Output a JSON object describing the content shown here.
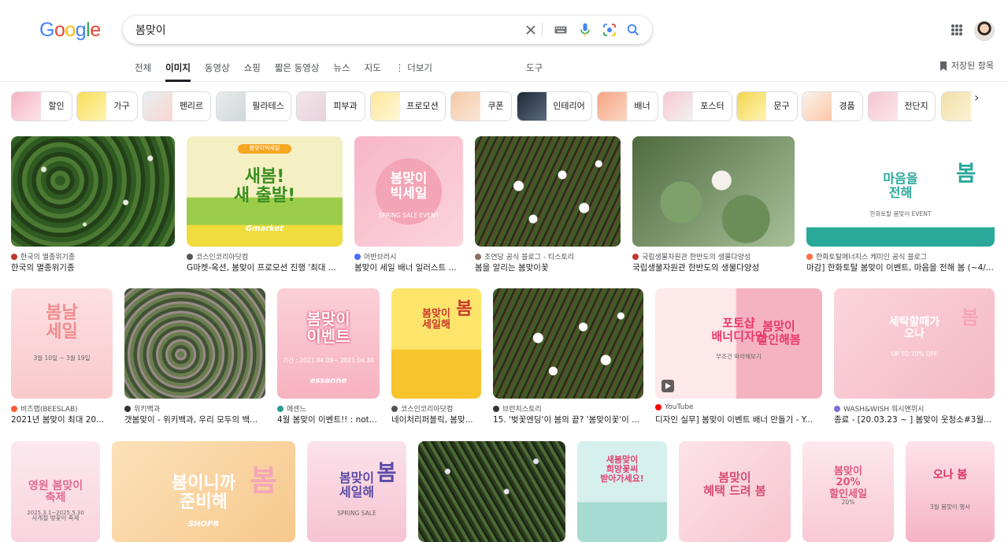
{
  "header": {
    "logo": "Google",
    "search_query": "봄맞이",
    "tabs": [
      "전체",
      "이미지",
      "동영상",
      "쇼핑",
      "짧은 동영상",
      "뉴스",
      "지도",
      "더보기"
    ],
    "tools_label": "도구",
    "saved_label": "저장된 항목"
  },
  "chips": [
    "할인",
    "가구",
    "펜리르",
    "필라테스",
    "피부과",
    "프로모션",
    "쿠폰",
    "인테리어",
    "배너",
    "포스터",
    "문구",
    "경품",
    "전단지"
  ],
  "row1": [
    {
      "source": "한국의 멸종위기종",
      "title": "한국의 멸종위기종"
    },
    {
      "source": "코스인코리아닷컴",
      "title": "G마켓-옥션, 봄맞이 프로모션 진행 '최대 ...",
      "text": "새봄!\n새 출발!",
      "badge": "봄맞이빅세일",
      "brand": "Gmarket"
    },
    {
      "source": "어반브러시",
      "title": "봄맞이 세일 배너 일러스트 ...",
      "text": "봄맞이\n빅세일",
      "small": "SPRING SALE EVENT"
    },
    {
      "source": "초연당 공식 블로그 - 티스토리",
      "title": "봄을 알리는 봄맞이꽃"
    },
    {
      "source": "국립생물자원관 한반도의 생물다양성",
      "title": "국립생물자원관 한반도의 생물다양성"
    },
    {
      "source": "한화토탈에너지스 케미인 공식 블로그",
      "title": "마감] 한화토탈 봄맞이 이벤트, 마음을 전해 봄 (~4/...",
      "text": "마음을\n전해",
      "big": "봄",
      "small": "한화토탈 봄맞이 EVENT"
    }
  ],
  "row2": [
    {
      "source": "비즈랩(BEESLAB)",
      "title": "2021년 봄맞이 최대 20...",
      "text": "봄날\n세일",
      "small": "3월 10일 ~ 3월 19일"
    },
    {
      "source": "위키백과",
      "title": "갯봄맞이 - 위키백과, 우리 모두의 백..."
    },
    {
      "source": "에센느",
      "title": "4월 봄맞이 이벤트!! : not...",
      "text": "봄맞이\n이벤트",
      "brand": "essanne",
      "small": "기간 : 2021.04.09~ 2021.04.30"
    },
    {
      "source": "코스인코리아닷컴",
      "title": "네이처리퍼블릭, 봄맞...",
      "text": "봄맞이\n세일해",
      "big": "봄"
    },
    {
      "source": "브런치스토리",
      "title": "15. '벚꽃엔딩'이 봄의 끝? '봄맞이꽃'이 ..."
    },
    {
      "source": "YouTube",
      "title": "디자인 실무] 봄맞이 이벤트 배너 만들기 - Y...",
      "text": "포토샵\n배너디자인",
      "small": "무조건 따라해보기",
      "text2": "봄맞이\n할인해봄"
    },
    {
      "source": "WASH&WISH 워시앤위시",
      "title": "종료 - [20.03.23 ~ ] 봄맞이 웃청소#3월...",
      "text": "세탁할때가\n오나",
      "big": "봄",
      "small": "UP TO 70% OFF"
    }
  ],
  "row3": [
    {
      "text": "영원 봄맞이\n축제",
      "small": "사계절 벚꽃이 축제",
      "small2": "2025.3.1~2025.5.30"
    },
    {
      "text": "봄이니까\n준비해",
      "big": "봄",
      "brand": "SHOPB"
    },
    {
      "text": "봄맞이\n세일해",
      "big": "봄",
      "small": "SPRING SALE"
    },
    {},
    {
      "text": "새봄맞이\n희망꽃씨\n받아가세요!"
    },
    {
      "text": "봄맞이\n혜택 드려 봄"
    },
    {
      "text": "봄맞이\n20%\n할인세일",
      "small": "20%"
    },
    {
      "text": "오나 봄",
      "small": "3월 봄맞이 행사"
    }
  ]
}
